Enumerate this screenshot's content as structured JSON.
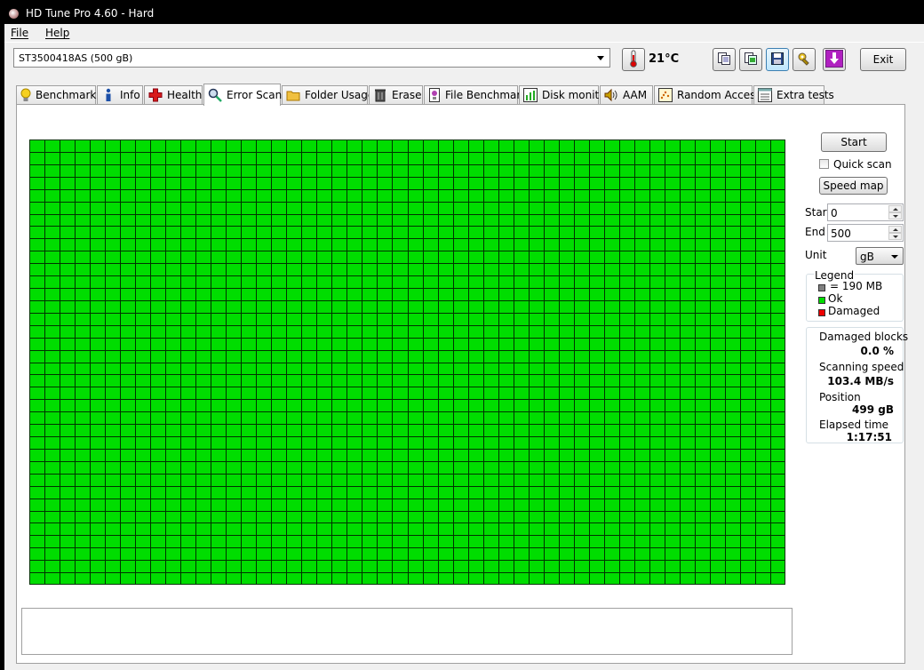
{
  "window": {
    "title": "HD Tune Pro 4.60 - Hard"
  },
  "menu": {
    "file": "File",
    "help": "Help"
  },
  "drive": {
    "selected": "ST3500418AS (500 gB)"
  },
  "temperature": "21°C",
  "toolbar": {
    "exit_label": "Exit"
  },
  "tabs": [
    {
      "label": "Benchmark",
      "icon": "bulb-icon"
    },
    {
      "label": "Info",
      "icon": "info-icon"
    },
    {
      "label": "Health",
      "icon": "health-cross-icon"
    },
    {
      "label": "Error Scan",
      "icon": "magnifier-icon",
      "active": true
    },
    {
      "label": "Folder Usage",
      "icon": "folder-icon"
    },
    {
      "label": "Erase",
      "icon": "trash-icon"
    },
    {
      "label": "File Benchmark",
      "icon": "file-benchmark-icon"
    },
    {
      "label": "Disk monitor",
      "icon": "disk-monitor-icon"
    },
    {
      "label": "AAM",
      "icon": "speaker-icon"
    },
    {
      "label": "Random Access",
      "icon": "random-access-icon"
    },
    {
      "label": "Extra tests",
      "icon": "extra-tests-icon"
    }
  ],
  "scan": {
    "start_button": "Start",
    "quick_scan_label": "Quick scan",
    "quick_scan_checked": false,
    "speed_map_button": "Speed map",
    "start_label": "Start",
    "start_value": "0",
    "end_label": "End",
    "end_value": "500",
    "unit_label": "Unit",
    "unit_value": "gB",
    "block_color_ok": "#00dd00"
  },
  "legend": {
    "title": "Legend",
    "items": [
      {
        "label": "= 190 MB",
        "color": "#808080"
      },
      {
        "label": "Ok",
        "color": "#00dd00"
      },
      {
        "label": "Damaged",
        "color": "#ee0000"
      }
    ]
  },
  "stats": {
    "damaged_blocks_label": "Damaged blocks",
    "damaged_blocks_value": "0.0 %",
    "scanning_speed_label": "Scanning speed",
    "scanning_speed_value": "103.4 MB/s",
    "position_label": "Position",
    "position_value": "499 gB",
    "elapsed_label": "Elapsed time",
    "elapsed_value": "1:17:51"
  }
}
